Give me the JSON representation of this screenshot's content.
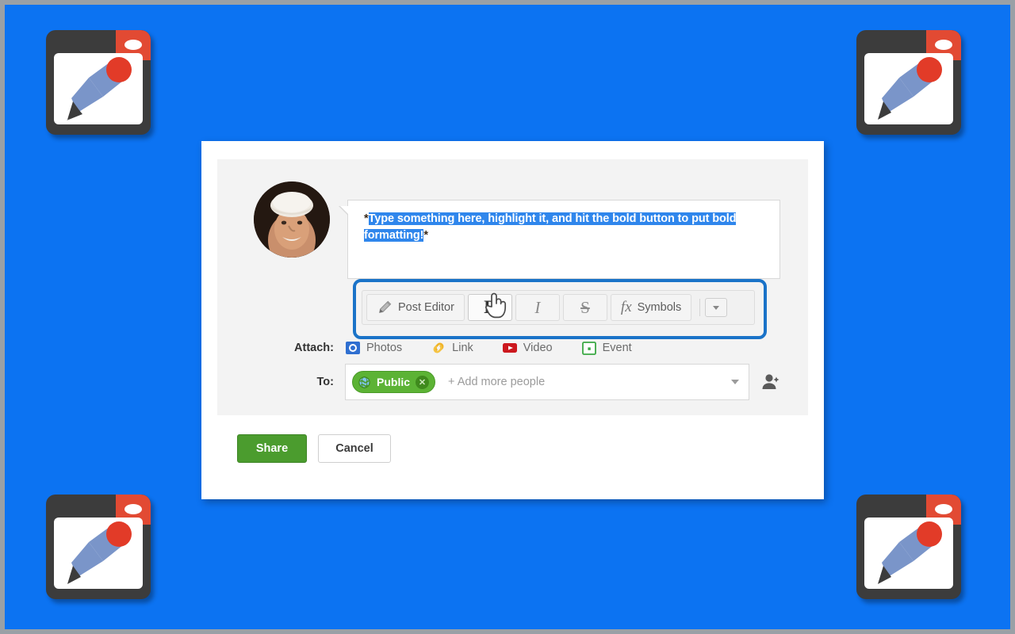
{
  "theme": {
    "background": "#0c73f2",
    "frame_border": "#9aa0a6",
    "highlight": "#1a73c8",
    "selection": "#2f86ec",
    "share_green": "#4b9c2e",
    "chip_green": "#5cb335"
  },
  "app_icon": {
    "name": "post-editor-app-icon",
    "frame_color": "#3c3c3c",
    "tab_color": "#e24a33",
    "pencil_body": "#7a95c9",
    "pencil_eraser": "#e23b28"
  },
  "compose": {
    "avatar_alt": "User profile photo",
    "text_leading_star": "*",
    "text_selected": "Type something here, highlight it, and hit the bold button to put bold formatting!",
    "text_trailing_star": "*"
  },
  "toolbar": {
    "post_editor_label": "Post Editor",
    "bold_label": "B",
    "italic_label": "I",
    "strikethrough_label": "S",
    "symbols_glyph": "fx",
    "symbols_label": "Symbols",
    "overflow_label": "",
    "hovered_button": "bold"
  },
  "attach": {
    "label": "Attach:",
    "items": [
      {
        "label": "Photos",
        "icon": "photos-icon",
        "color": "#2f6fd0"
      },
      {
        "label": "Link",
        "icon": "link-icon",
        "color": "#f0b429"
      },
      {
        "label": "Video",
        "icon": "video-icon",
        "color": "#cc181e"
      },
      {
        "label": "Event",
        "icon": "event-icon",
        "color": "#3aa843"
      }
    ]
  },
  "audience": {
    "label": "To:",
    "chip_label": "Public",
    "chip_close_glyph": "✕",
    "placeholder": "+ Add more people"
  },
  "footer": {
    "share_label": "Share",
    "cancel_label": "Cancel"
  }
}
